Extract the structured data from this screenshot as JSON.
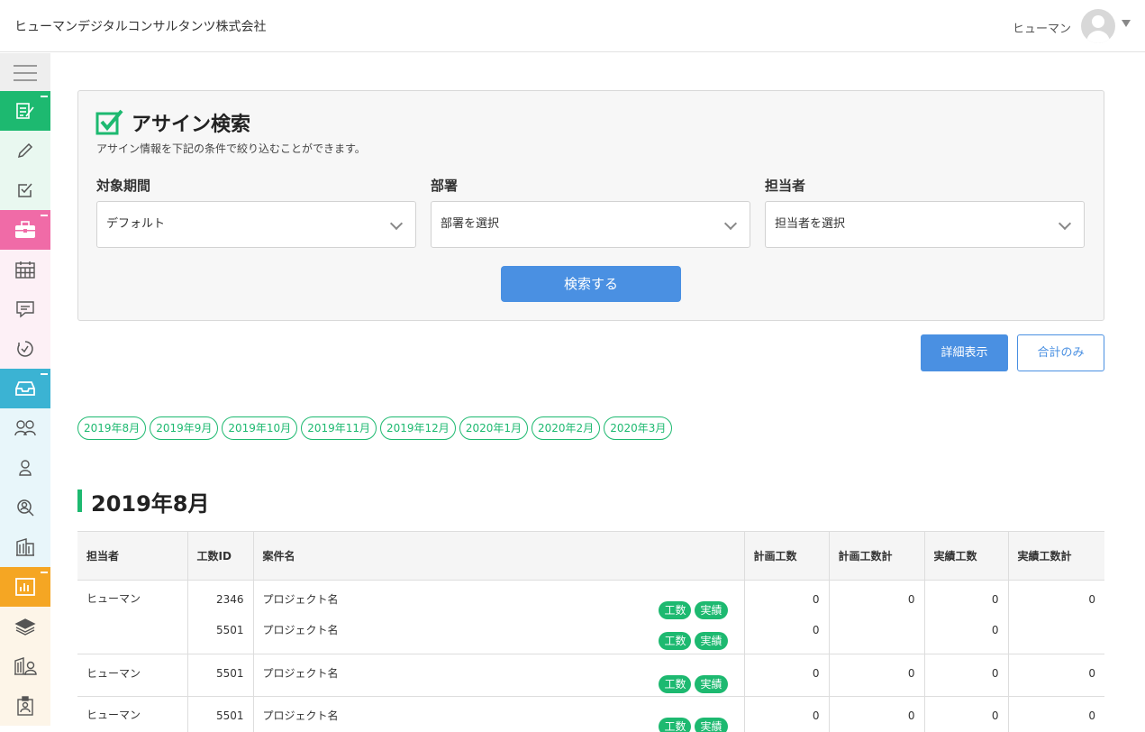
{
  "header": {
    "company": "ヒューマンデジタルコンサルタンツ株式会社",
    "user_name": "ヒューマン"
  },
  "sidebar": {
    "items": [
      {
        "icon": "menu-icon"
      },
      {
        "icon": "report-edit-icon",
        "color": "#1db970",
        "group_head": true
      },
      {
        "icon": "pencil-icon"
      },
      {
        "icon": "checkbox-icon"
      },
      {
        "icon": "briefcase-icon",
        "color": "#f06ba7",
        "group_head": true
      },
      {
        "icon": "calendar-icon"
      },
      {
        "icon": "comment-icon"
      },
      {
        "icon": "timer-icon"
      },
      {
        "icon": "inbox-icon",
        "color": "#3bb3d3",
        "group_head": true
      },
      {
        "icon": "group-icon"
      },
      {
        "icon": "person-icon"
      },
      {
        "icon": "user-search-icon"
      },
      {
        "icon": "building-icon"
      },
      {
        "icon": "bar-chart-icon",
        "color": "#f5a623",
        "group_head": true
      },
      {
        "icon": "layers-icon"
      },
      {
        "icon": "building-user-icon"
      },
      {
        "icon": "id-badge-icon"
      }
    ]
  },
  "search": {
    "title": "アサイン検索",
    "description": "アサイン情報を下記の条件で絞り込むことができます。",
    "period_label": "対象期間",
    "period_value": "デフォルト",
    "dept_label": "部署",
    "dept_value": "部署を選択",
    "staff_label": "担当者",
    "staff_value": "担当者を選択",
    "submit_label": "検索する"
  },
  "view_buttons": {
    "detail": "詳細表示",
    "total": "合計のみ"
  },
  "months": [
    "2019年8月",
    "2019年9月",
    "2019年10月",
    "2019年11月",
    "2019年12月",
    "2020年1月",
    "2020年2月",
    "2020年3月"
  ],
  "section": {
    "title": "2019年8月"
  },
  "table": {
    "headers": {
      "staff": "担当者",
      "id": "工数ID",
      "project": "案件名",
      "plan": "計画工数",
      "plan_total": "計画工数計",
      "actual": "実績工数",
      "actual_total": "実績工数計"
    },
    "tag_labels": {
      "hours": "工数",
      "results": "実績"
    },
    "rows": [
      {
        "staff": "ヒューマン",
        "lines": [
          {
            "id": "2346",
            "project": "プロジェクト名",
            "plan": "0",
            "actual": "0"
          },
          {
            "id": "5501",
            "project": "プロジェクト名",
            "plan": "0",
            "actual": "0"
          }
        ],
        "plan_total": "0",
        "actual_total": "0"
      },
      {
        "staff": "ヒューマン",
        "lines": [
          {
            "id": "5501",
            "project": "プロジェクト名",
            "plan": "0",
            "actual": "0"
          }
        ],
        "plan_total": "0",
        "actual_total": "0"
      },
      {
        "staff": "ヒューマン",
        "lines": [
          {
            "id": "5501",
            "project": "プロジェクト名",
            "plan": "0",
            "actual": "0"
          }
        ],
        "plan_total": "0",
        "actual_total": "0"
      }
    ]
  }
}
